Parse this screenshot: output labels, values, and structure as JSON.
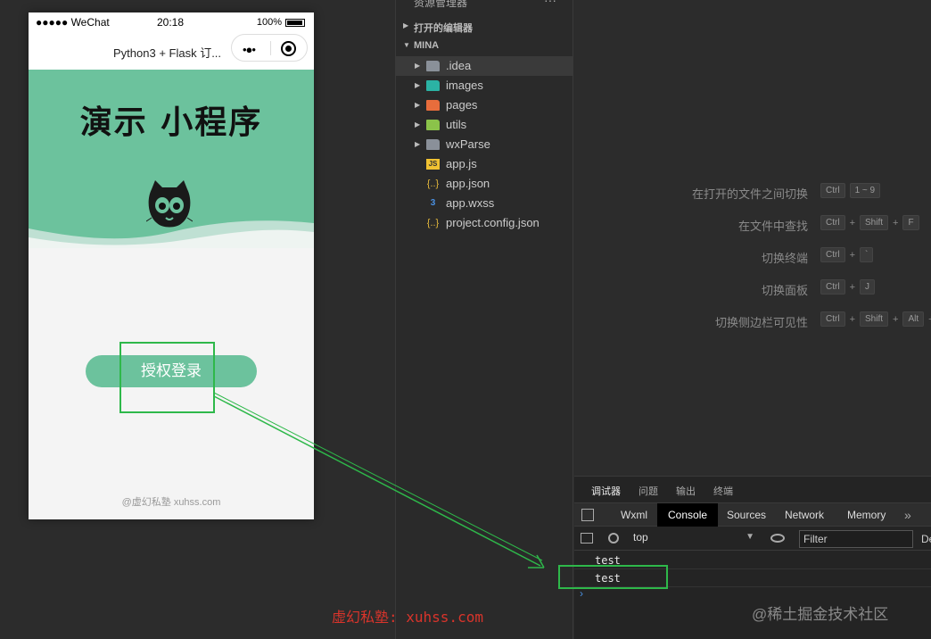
{
  "phone": {
    "status": {
      "carrier": "●●●●● WeChat",
      "wifi": "wifi-icon",
      "time": "20:18",
      "battery": "100%"
    },
    "nav_title": "Python3 + Flask 订...",
    "capsule": {
      "more": "•●•",
      "close": "target-icon"
    },
    "app_title": "演示 小程序",
    "login_button": "授权登录",
    "footer": "@虚幻私塾 xuhss.com"
  },
  "explorer": {
    "title": "资源管理器",
    "more": "···",
    "sections": {
      "open_editors": "打开的编辑器",
      "project": "MINA"
    },
    "items": [
      {
        "label": ".idea",
        "type": "folder"
      },
      {
        "label": "images",
        "type": "folder"
      },
      {
        "label": "pages",
        "type": "folder"
      },
      {
        "label": "utils",
        "type": "folder"
      },
      {
        "label": "wxParse",
        "type": "folder"
      },
      {
        "label": "app.js",
        "type": "js"
      },
      {
        "label": "app.json",
        "type": "json"
      },
      {
        "label": "app.wxss",
        "type": "wxss"
      },
      {
        "label": "project.config.json",
        "type": "json"
      }
    ]
  },
  "shortcuts": [
    {
      "label": "在打开的文件之间切换",
      "keys": [
        "Ctrl",
        "1 ~ 9"
      ]
    },
    {
      "label": "在文件中查找",
      "keys": [
        "Ctrl",
        "+",
        "Shift",
        "+",
        "F"
      ]
    },
    {
      "label": "切换终端",
      "keys": [
        "Ctrl",
        "+",
        "`"
      ]
    },
    {
      "label": "切换面板",
      "keys": [
        "Ctrl",
        "+",
        "J"
      ]
    },
    {
      "label": "切换侧边栏可见性",
      "keys": [
        "Ctrl",
        "+",
        "Shift",
        "+",
        "Alt",
        "+"
      ]
    }
  ],
  "debugger": {
    "tabs": [
      "调试器",
      "问题",
      "输出",
      "终端"
    ],
    "devtools_tabs": [
      "Wxml",
      "Console",
      "Sources",
      "Network",
      "Memory"
    ],
    "more": "»",
    "context": "top",
    "filter_placeholder": "Filter",
    "levels": "De",
    "logs": [
      "test",
      "test"
    ],
    "prompt": "›"
  },
  "watermarks": {
    "red": "虚幻私塾: xuhss.com",
    "site": "@稀土掘金技术社区"
  },
  "colors": {
    "accent_green": "#6cc29d",
    "highlight": "#2eb84a",
    "link_blue": "#4a90e2"
  }
}
